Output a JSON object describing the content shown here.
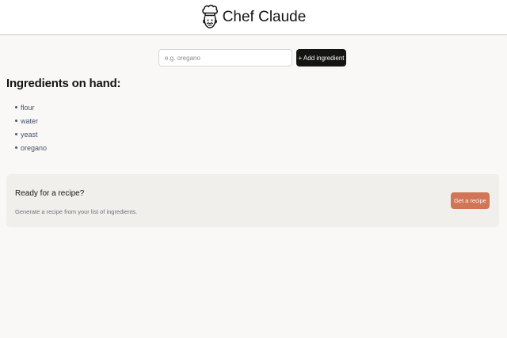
{
  "header": {
    "title": "Chef Claude",
    "logo_icon": "chef-hat-face-icon"
  },
  "form": {
    "input_value": "",
    "input_placeholder": "e.g. oregano",
    "add_button_label": "+ Add ingredient"
  },
  "ingredients": {
    "heading": "Ingredients on hand:",
    "items": [
      "flour",
      "water",
      "yeast",
      "oregano"
    ]
  },
  "recipe_panel": {
    "title": "Ready for a recipe?",
    "description": "Generate a recipe from your list of ingredients.",
    "button_label": "Get a recipe"
  },
  "colors": {
    "page_background": "#f9f8f6",
    "header_background": "#ffffff",
    "primary_button": "#141413",
    "accent_button": "#d17557",
    "panel_background": "#f0efeb"
  }
}
